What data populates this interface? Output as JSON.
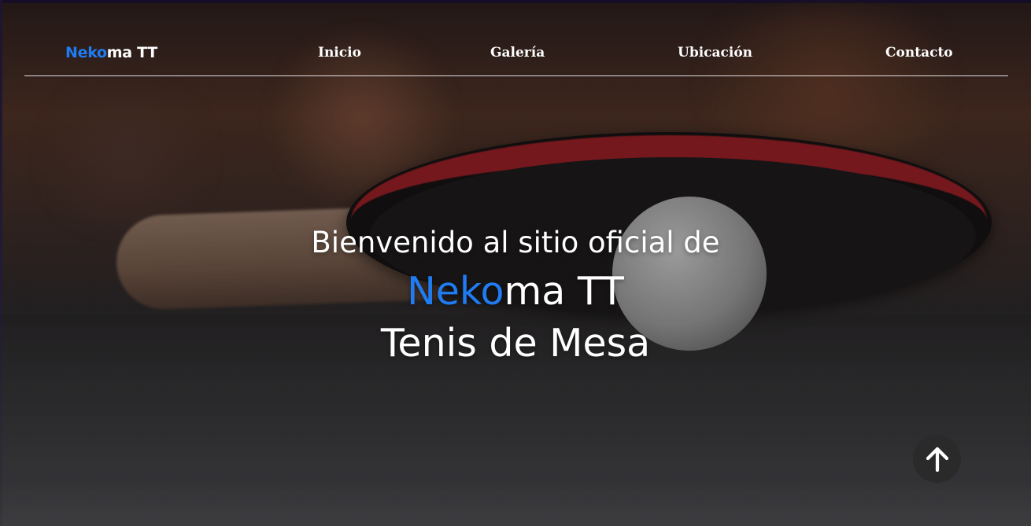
{
  "navbar": {
    "brand_accent": "Neko",
    "brand_rest": "ma TT",
    "links": [
      {
        "label": "Inicio"
      },
      {
        "label": "Galería"
      },
      {
        "label": "Ubicación"
      },
      {
        "label": "Contacto"
      }
    ]
  },
  "hero": {
    "line1": "Bienvenido al sitio oficial de",
    "line2_accent": "Neko",
    "line2_rest": "ma TT",
    "line3": "Tenis de Mesa"
  },
  "scroll_top": {
    "icon": "arrow-up-icon"
  },
  "colors": {
    "accent": "#1f7cf2",
    "text": "#ffffff",
    "scroll_button_bg": "#2a2a2b"
  }
}
